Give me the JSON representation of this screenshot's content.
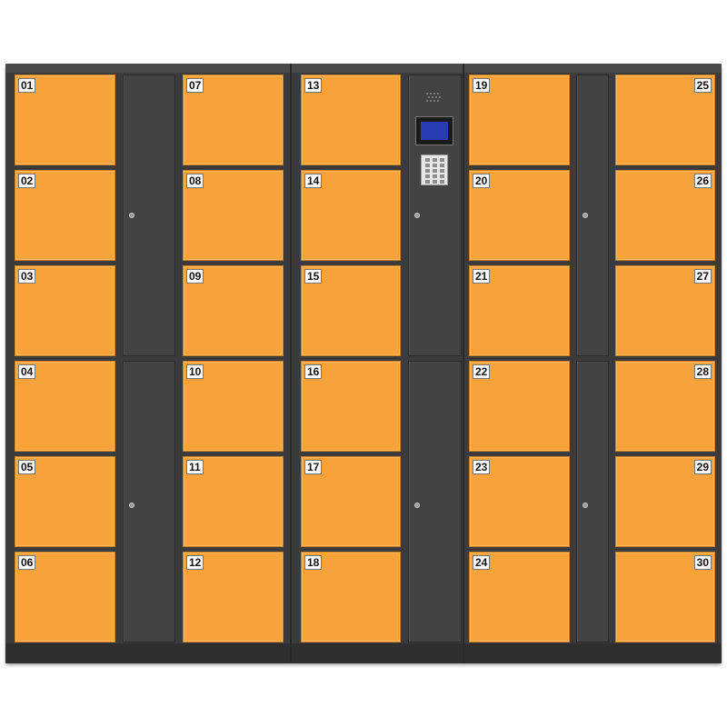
{
  "colors": {
    "door": "#f7a23a",
    "cabinet": "#3b3b3b",
    "screen": "#2b3db5"
  },
  "columns": [
    {
      "labels": [
        "01",
        "02",
        "03",
        "04",
        "05",
        "06"
      ]
    },
    {
      "labels": [
        "07",
        "08",
        "09",
        "10",
        "11",
        "12"
      ]
    },
    {
      "labels": [
        "13",
        "14",
        "15",
        "16",
        "17",
        "18"
      ]
    },
    {
      "labels": [
        "19",
        "20",
        "21",
        "22",
        "23",
        "24"
      ]
    },
    {
      "labels": [
        "25",
        "26",
        "27",
        "28",
        "29",
        "30"
      ]
    }
  ],
  "control_panel": {
    "screen_icon": "lcd-screen-icon",
    "keypad_icon": "keypad-icon",
    "speaker_icon": "speaker-grille-icon"
  },
  "side_panels": {
    "lock_icon": "keyhole-icon"
  }
}
